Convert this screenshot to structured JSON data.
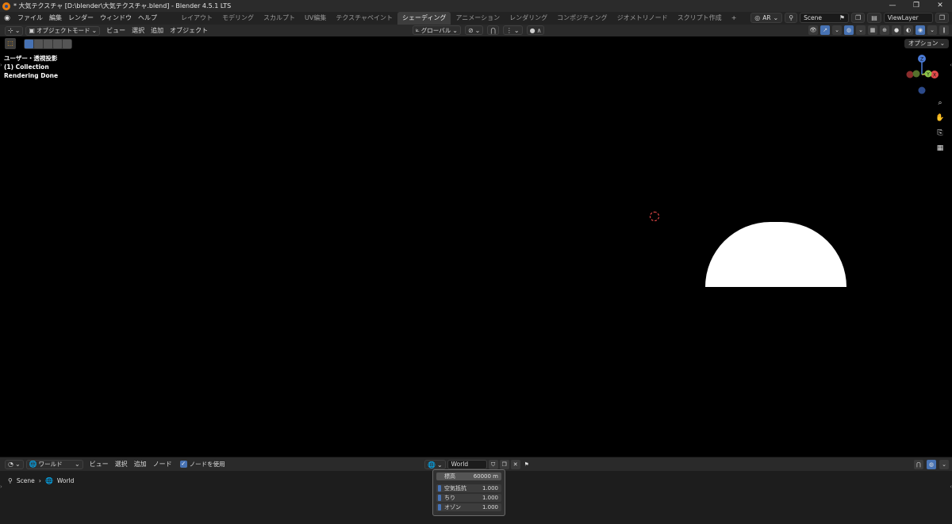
{
  "window": {
    "title": "* 大気テクスチャ [D:\\blender\\大気テクスチャ.blend] - Blender 4.5.1 LTS",
    "controls": [
      "—",
      "❐",
      "✕"
    ]
  },
  "menu": [
    "ファイル",
    "編集",
    "レンダー",
    "ウィンドウ",
    "ヘルプ"
  ],
  "workspace_tabs": [
    "レイアウト",
    "モデリング",
    "スカルプト",
    "UV編集",
    "テクスチャペイント",
    "シェーディング",
    "アニメーション",
    "レンダリング",
    "コンポジティング",
    "ジオメトリノード",
    "スクリプト作成"
  ],
  "active_tab": "シェーディング",
  "topbar_right": {
    "ar": "AR",
    "scene": "Scene",
    "view_layer": "ViewLayer"
  },
  "viewport_header": {
    "mode": "オブジェクトモード",
    "menu": [
      "ビュー",
      "選択",
      "追加",
      "オブジェクト"
    ],
    "orientation": "グローバル"
  },
  "viewport": {
    "overlay": [
      "ユーザー・透視投影",
      "(1) Collection",
      "Rendering Done"
    ],
    "options_label": "オプション",
    "gizmo_axes": [
      "Z",
      "Y",
      "X"
    ],
    "accent_color": "#4772b3"
  },
  "node_header": {
    "type": "ワールド",
    "menu": [
      "ビュー",
      "選択",
      "追加",
      "ノード"
    ],
    "use_nodes_label": "ノードを使用",
    "use_nodes_checked": true,
    "world_name": "World"
  },
  "breadcrumb": {
    "scene": "Scene",
    "world": "World"
  },
  "node": {
    "altitude_label": "標高",
    "altitude_value": "60000 m",
    "rows": [
      {
        "label": "空気抵抗",
        "value": "1.000"
      },
      {
        "label": "ちり",
        "value": "1.000"
      },
      {
        "label": "オゾン",
        "value": "1.000"
      }
    ]
  }
}
